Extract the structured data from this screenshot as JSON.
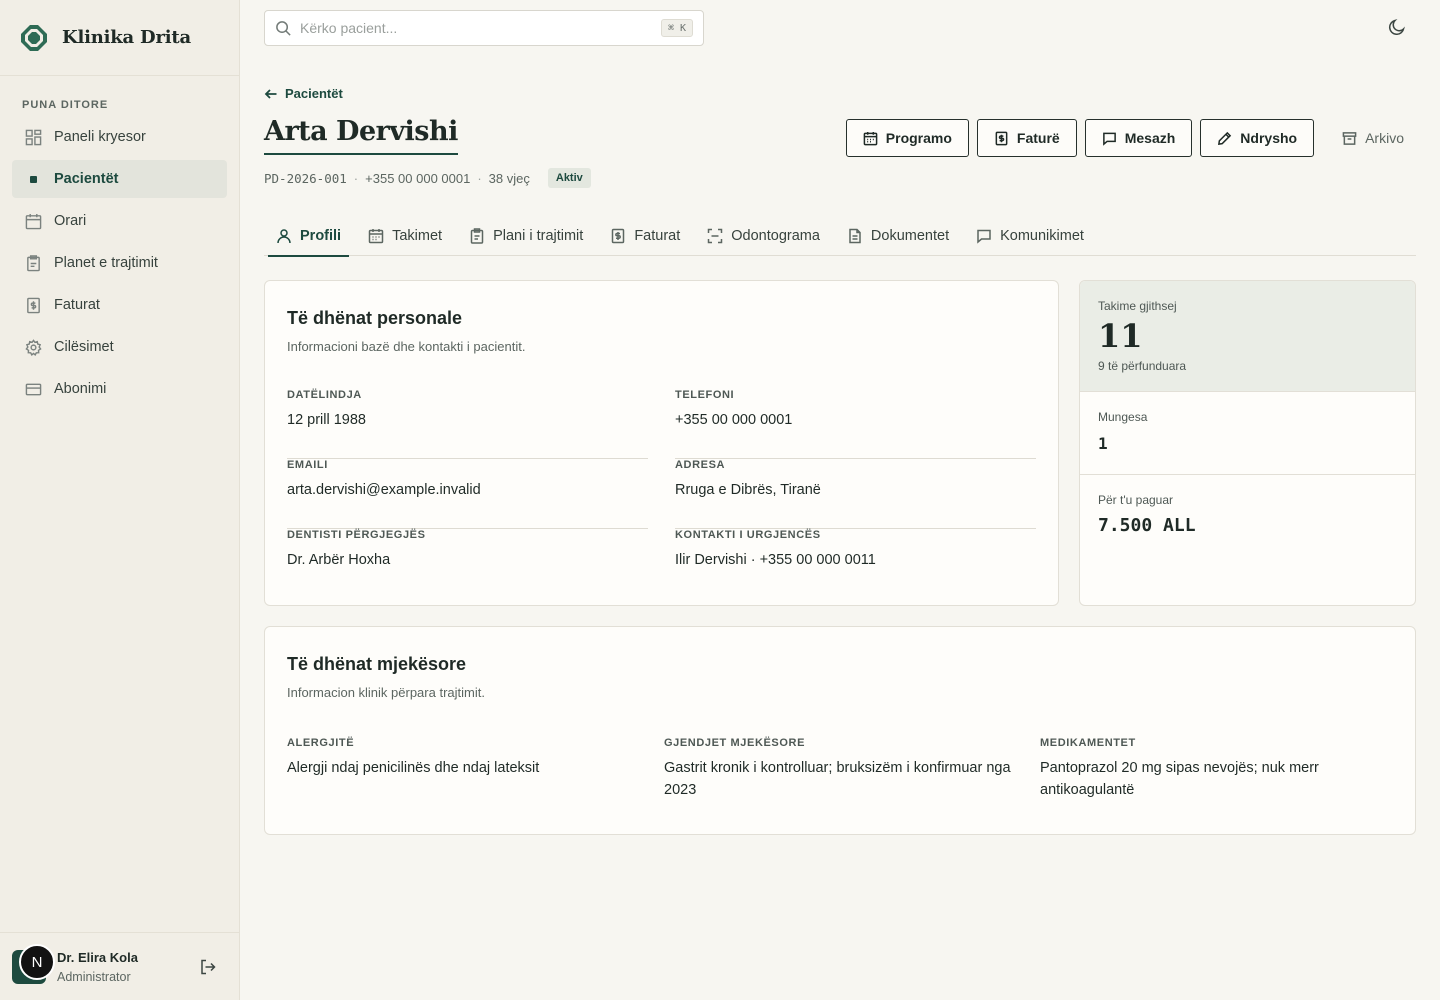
{
  "brand": {
    "name": "Klinika Drita"
  },
  "sidebar": {
    "section_label": "PUNA DITORE",
    "items": [
      {
        "label": "Paneli kryesor",
        "icon": "dashboard-icon"
      },
      {
        "label": "Pacientët",
        "icon": "active-dot",
        "active": true
      },
      {
        "label": "Orari",
        "icon": "calendar-icon"
      },
      {
        "label": "Planet e trajtimit",
        "icon": "clipboard-icon"
      },
      {
        "label": "Faturat",
        "icon": "invoice-icon"
      },
      {
        "label": "Cilësimet",
        "icon": "gear-icon"
      },
      {
        "label": "Abonimi",
        "icon": "credit-card-icon"
      }
    ],
    "user": {
      "initial": "N",
      "name": "Dr. Elira Kola",
      "role": "Administrator"
    }
  },
  "topbar": {
    "search_placeholder": "Kërko pacient...",
    "shortcut": "⌘ K"
  },
  "header": {
    "back_label": "Pacientët",
    "title": "Arta Dervishi",
    "patient_id": "PD-2026-001",
    "phone": "+355 00 000 0001",
    "age": "38 vjeç",
    "status": "Aktiv",
    "actions": {
      "schedule": "Programo",
      "invoice": "Faturë",
      "message": "Mesazh",
      "edit": "Ndrysho",
      "archive": "Arkivo"
    }
  },
  "tabs": [
    {
      "label": "Profili",
      "icon": "user-icon",
      "active": true
    },
    {
      "label": "Takimet",
      "icon": "calendar-icon"
    },
    {
      "label": "Plani i trajtimit",
      "icon": "clipboard-icon"
    },
    {
      "label": "Faturat",
      "icon": "invoice-icon"
    },
    {
      "label": "Odontograma",
      "icon": "scan-icon"
    },
    {
      "label": "Dokumentet",
      "icon": "document-icon"
    },
    {
      "label": "Komunikimet",
      "icon": "chat-icon"
    }
  ],
  "personal": {
    "title": "Të dhënat personale",
    "subtitle": "Informacioni bazë dhe kontakti i pacientit.",
    "fields": {
      "birthdate": {
        "label": "DATËLINDJA",
        "value": "12 prill 1988"
      },
      "phone": {
        "label": "TELEFONI",
        "value": "+355 00 000 0001"
      },
      "email": {
        "label": "EMAILI",
        "value": "arta.dervishi@example.invalid"
      },
      "address": {
        "label": "ADRESA",
        "value": "Rruga e Dibrës, Tiranë"
      },
      "dentist": {
        "label": "DENTISTI PËRGJEGJËS",
        "value": "Dr. Arbër Hoxha"
      },
      "emergency": {
        "label": "KONTAKTI I URGJENCËS",
        "value": "Ilir Dervishi · +355 00 000 0011"
      }
    }
  },
  "stats": {
    "total": {
      "label": "Takime gjithsej",
      "value": "11",
      "note": "9 të përfunduara"
    },
    "absences": {
      "label": "Mungesa",
      "value": "1"
    },
    "due": {
      "label": "Për t'u paguar",
      "value": "7.500 ALL"
    }
  },
  "medical": {
    "title": "Të dhënat mjekësore",
    "subtitle": "Informacion klinik përpara trajtimit.",
    "allergies": {
      "label": "ALERGJITË",
      "value": "Alergji ndaj penicilinës dhe ndaj lateksit"
    },
    "conditions": {
      "label": "GJENDJET MJEKËSORE",
      "value": "Gastrit kronik i kontrolluar; bruksizëm i konfirmuar nga 2023"
    },
    "medications": {
      "label": "MEDIKAMENTET",
      "value": "Pantoprazol 20 mg sipas nevojës; nuk merr antikoagulantë"
    }
  },
  "colors": {
    "accent": "#1d4a3f",
    "background": "#f7f6f1",
    "sidebar": "#f1eee6"
  }
}
